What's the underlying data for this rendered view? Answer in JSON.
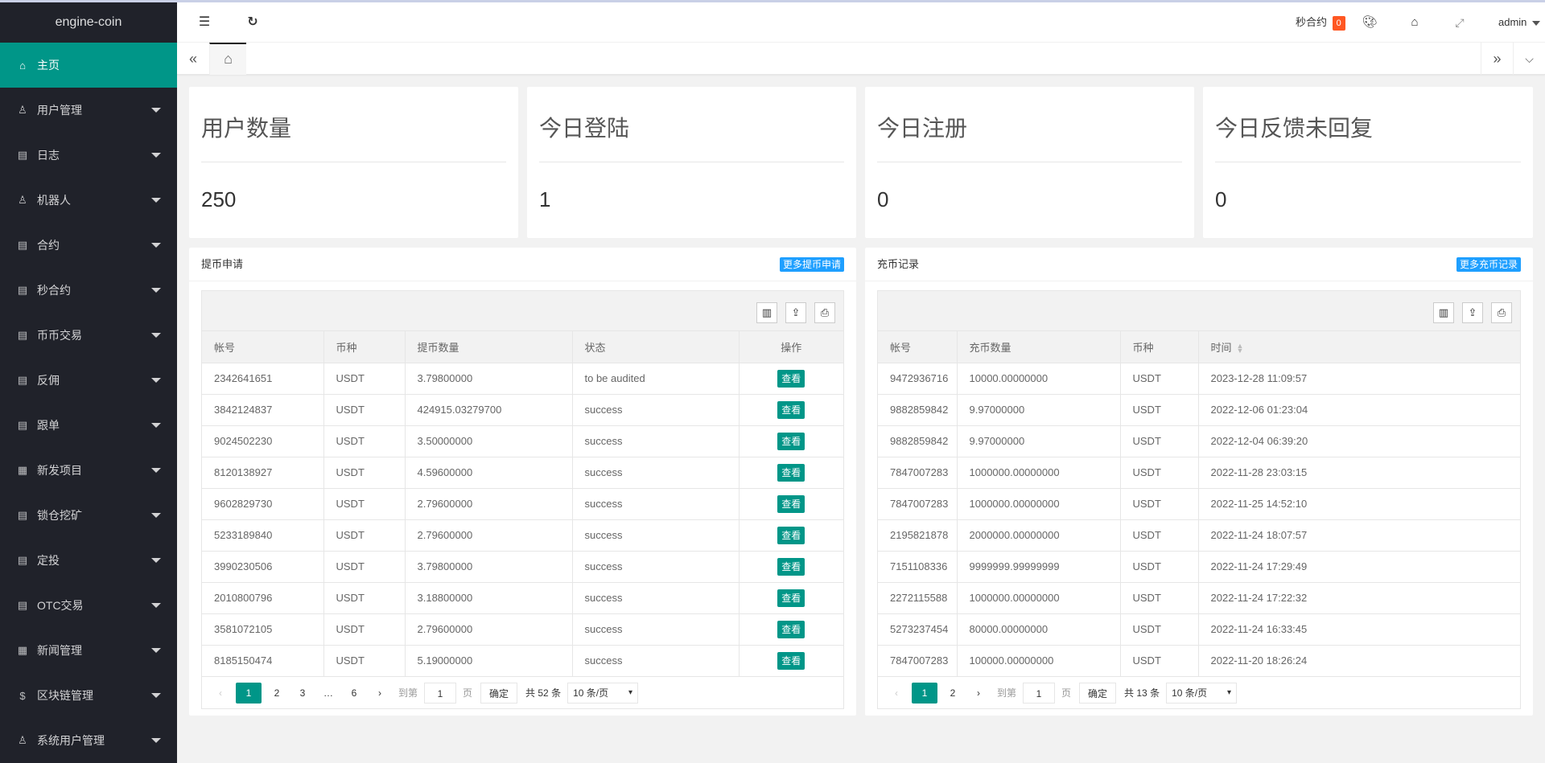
{
  "app": {
    "title": "engine-coin"
  },
  "sidebar": {
    "items": [
      {
        "label": "主页",
        "icon": "home-icon",
        "active": true
      },
      {
        "label": "用户管理",
        "icon": "user-icon"
      },
      {
        "label": "日志",
        "icon": "document-icon"
      },
      {
        "label": "机器人",
        "icon": "user-icon"
      },
      {
        "label": "合约",
        "icon": "document-icon"
      },
      {
        "label": "秒合约",
        "icon": "document-icon"
      },
      {
        "label": "币币交易",
        "icon": "document-icon"
      },
      {
        "label": "反佣",
        "icon": "document-icon"
      },
      {
        "label": "跟单",
        "icon": "document-icon"
      },
      {
        "label": "新发项目",
        "icon": "news-icon"
      },
      {
        "label": "锁仓挖矿",
        "icon": "document-icon"
      },
      {
        "label": "定投",
        "icon": "document-icon"
      },
      {
        "label": "OTC交易",
        "icon": "document-icon"
      },
      {
        "label": "新闻管理",
        "icon": "news-icon"
      },
      {
        "label": "区块链管理",
        "icon": "dollar-icon"
      },
      {
        "label": "系统用户管理",
        "icon": "user-icon"
      }
    ]
  },
  "header": {
    "second_contract_label": "秒合约",
    "second_contract_badge": "0",
    "user": "admin",
    "badge_color": "#ff5722"
  },
  "stats": [
    {
      "title": "用户数量",
      "value": "250"
    },
    {
      "title": "今日登陆",
      "value": "1"
    },
    {
      "title": "今日注册",
      "value": "0"
    },
    {
      "title": "今日反馈未回复",
      "value": "0"
    }
  ],
  "withdraw": {
    "title": "提币申请",
    "more": "更多提币申请",
    "columns": [
      "帐号",
      "币种",
      "提币数量",
      "状态",
      "操作"
    ],
    "action_label": "查看",
    "rows": [
      [
        "2342641651",
        "USDT",
        "3.79800000",
        "to be audited"
      ],
      [
        "3842124837",
        "USDT",
        "424915.03279700",
        "success"
      ],
      [
        "9024502230",
        "USDT",
        "3.50000000",
        "success"
      ],
      [
        "8120138927",
        "USDT",
        "4.59600000",
        "success"
      ],
      [
        "9602829730",
        "USDT",
        "2.79600000",
        "success"
      ],
      [
        "5233189840",
        "USDT",
        "2.79600000",
        "success"
      ],
      [
        "3990230506",
        "USDT",
        "3.79800000",
        "success"
      ],
      [
        "2010800796",
        "USDT",
        "3.18800000",
        "success"
      ],
      [
        "3581072105",
        "USDT",
        "2.79600000",
        "success"
      ],
      [
        "8185150474",
        "USDT",
        "5.19000000",
        "success"
      ]
    ],
    "pager": {
      "pages": [
        "1",
        "2",
        "3",
        "…",
        "6"
      ],
      "goto": "到第",
      "page_value": "1",
      "page_unit": "页",
      "confirm": "确定",
      "total": "共 52 条",
      "per_page": "10 条/页"
    }
  },
  "deposit": {
    "title": "充币记录",
    "more": "更多充币记录",
    "columns": [
      "帐号",
      "充币数量",
      "币种",
      "时间"
    ],
    "rows": [
      [
        "9472936716",
        "10000.00000000",
        "USDT",
        "2023-12-28 11:09:57"
      ],
      [
        "9882859842",
        "9.97000000",
        "USDT",
        "2022-12-06 01:23:04"
      ],
      [
        "9882859842",
        "9.97000000",
        "USDT",
        "2022-12-04 06:39:20"
      ],
      [
        "7847007283",
        "1000000.00000000",
        "USDT",
        "2022-11-28 23:03:15"
      ],
      [
        "7847007283",
        "1000000.00000000",
        "USDT",
        "2022-11-25 14:52:10"
      ],
      [
        "2195821878",
        "2000000.00000000",
        "USDT",
        "2022-11-24 18:07:57"
      ],
      [
        "7151108336",
        "9999999.99999999",
        "USDT",
        "2022-11-24 17:29:49"
      ],
      [
        "2272115588",
        "1000000.00000000",
        "USDT",
        "2022-11-24 17:22:32"
      ],
      [
        "5273237454",
        "80000.00000000",
        "USDT",
        "2022-11-24 16:33:45"
      ],
      [
        "7847007283",
        "100000.00000000",
        "USDT",
        "2022-11-20 18:26:24"
      ]
    ],
    "pager": {
      "pages": [
        "1",
        "2"
      ],
      "goto": "到第",
      "page_value": "1",
      "page_unit": "页",
      "confirm": "确定",
      "total": "共 13 条",
      "per_page": "10 条/页"
    }
  }
}
